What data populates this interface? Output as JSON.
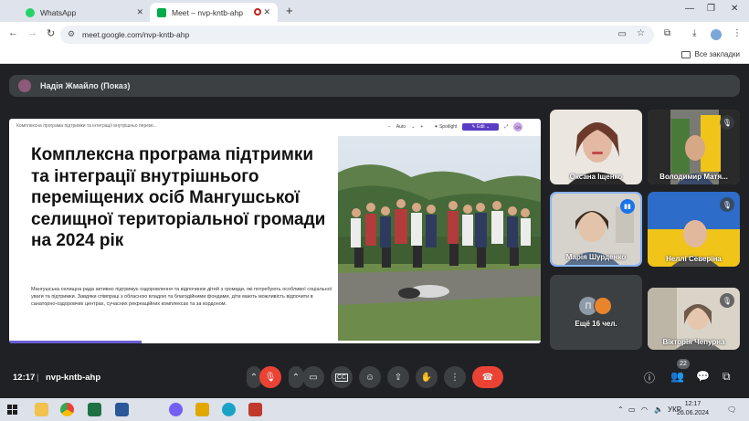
{
  "browser": {
    "tabs": [
      {
        "label": "WhatsApp",
        "active": false
      },
      {
        "label": "Meet – nvp-kntb-ahp",
        "active": true
      }
    ],
    "new_tab": "+",
    "url": "meet.google.com/nvp-kntb-ahp",
    "bookmarks_label": "Все закладки"
  },
  "meet": {
    "presenter": "Надія Жмайло (Показ)",
    "slide": {
      "breadcrumb": "Комплексна програма підтримки та інтеграції внутрішньо перемі...",
      "title": "Комплексна програма підтримки та інтеграції внутрішнього переміщених осіб Мангушської селищної територіальної громади на 2024 рік",
      "body": "Мангушська селищна рада активно підтримує оздоровлення та відпочинок дітей з громади, які потребують особливої соціальної уваги та підтримки. Завдяки співпраці з обласною владою та благодійними фондами, діти мають можливість відпочити в санаторно-оздоровчих центрах, сучасних рекреаційних комплексах та за кордоном.",
      "toolbar": {
        "zoom": "Auto",
        "minus": "−",
        "plus": "+",
        "spotlight": "Spotlight",
        "edit": "Edit",
        "avatar_initials": "CR"
      }
    },
    "tiles": [
      {
        "name": "Оксана Іщенко",
        "muted": false,
        "speaking": false
      },
      {
        "name": "Володимир Матя...",
        "muted": true,
        "speaking": false
      },
      {
        "name": "Марія Шурденко",
        "muted": false,
        "speaking": true
      },
      {
        "name": "Неллі Северіна",
        "muted": true,
        "speaking": false
      },
      {
        "name": "Ещё 16 чел.",
        "initial": "П",
        "muted": false,
        "speaking": false
      },
      {
        "name": "Вікторія Чепурна",
        "muted": true,
        "speaking": false
      }
    ],
    "controls": {
      "time": "12:17",
      "separator": "|",
      "meeting_code": "nvp-kntb-ahp",
      "participants_badge": "22"
    }
  },
  "taskbar": {
    "lang": "УКР",
    "time": "12:17",
    "date": "26.06.2024"
  },
  "colors": {
    "meet_bg": "#202124",
    "end_call": "#ea4335",
    "mic_off": "#ea4335",
    "accent": "#8ab4f8",
    "edit": "#5b3cc4"
  }
}
